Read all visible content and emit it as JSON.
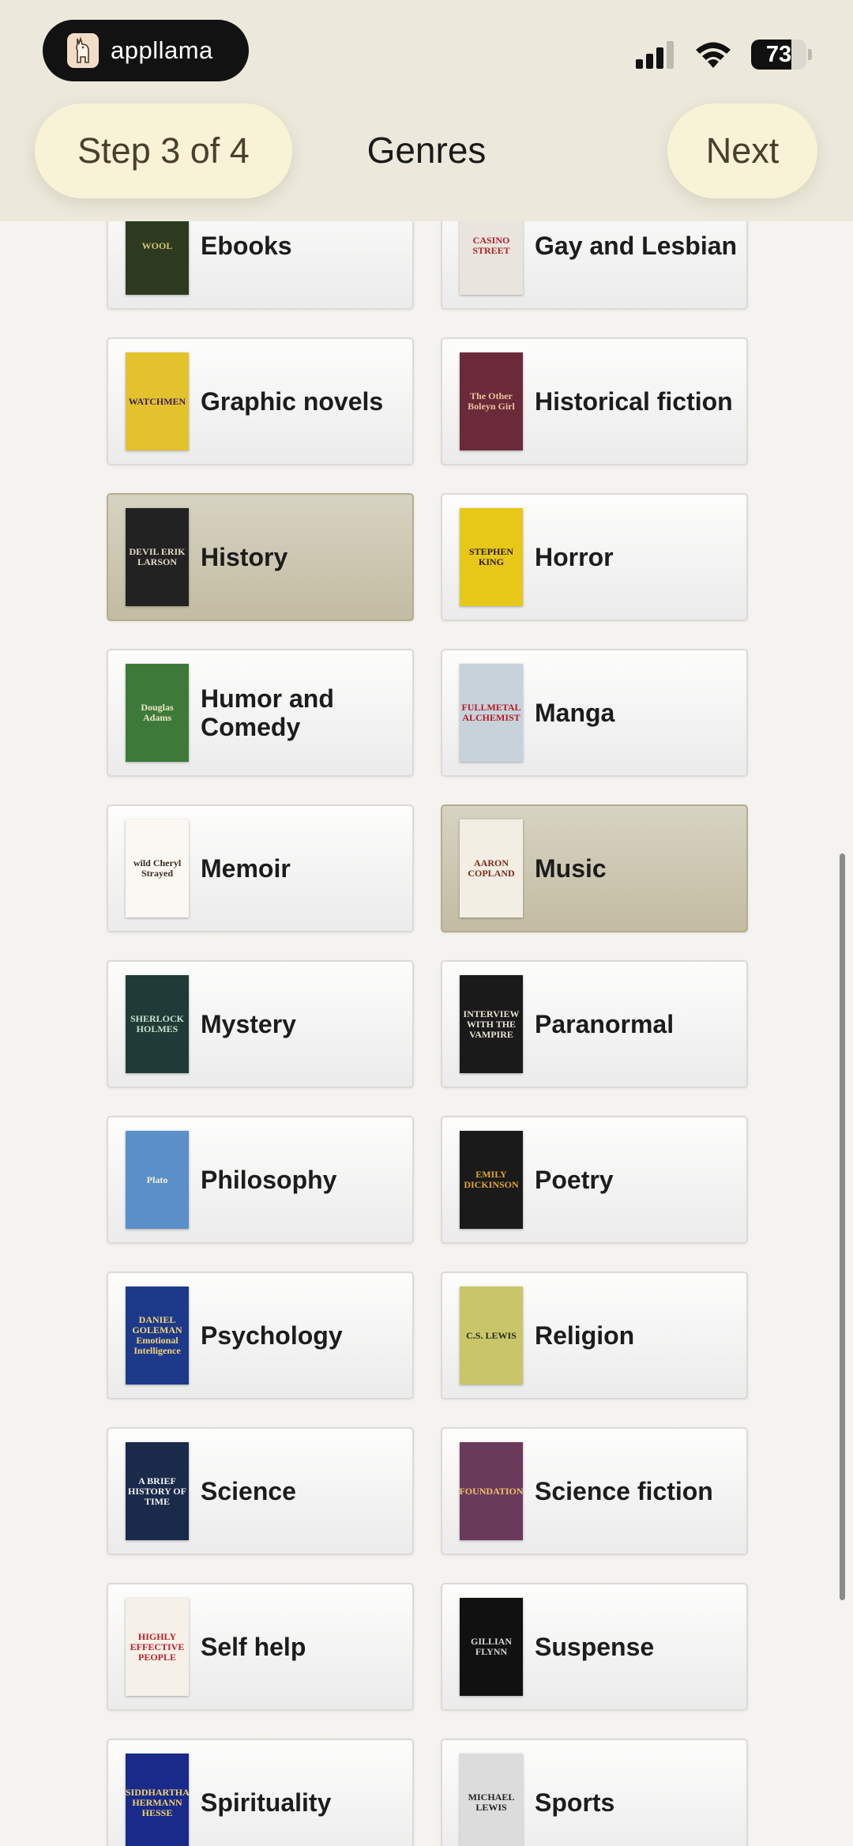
{
  "app": {
    "name": "appllama"
  },
  "status": {
    "battery": "73",
    "battery_fraction": 0.73
  },
  "header": {
    "step_label": "Step 3 of 4",
    "title": "Genres",
    "next_label": "Next"
  },
  "genres": [
    {
      "label": "Ebooks",
      "selected": false,
      "cover_text": "WOOL",
      "cover_bg": "#2d3a1f",
      "cover_fg": "#d7c27a"
    },
    {
      "label": "Gay and Lesbian",
      "selected": false,
      "cover_text": "CASINO STREET",
      "cover_bg": "#e9e4de",
      "cover_fg": "#b0222a"
    },
    {
      "label": "Graphic novels",
      "selected": false,
      "cover_text": "WATCHMEN",
      "cover_bg": "#e3c22d",
      "cover_fg": "#3a1d5c"
    },
    {
      "label": "Historical fiction",
      "selected": false,
      "cover_text": "The Other Boleyn Girl",
      "cover_bg": "#6b2a3a",
      "cover_fg": "#e9c49a"
    },
    {
      "label": "History",
      "selected": true,
      "cover_text": "DEVIL ERIK LARSON",
      "cover_bg": "#222222",
      "cover_fg": "#e0d8c4"
    },
    {
      "label": "Horror",
      "selected": false,
      "cover_text": "STEPHEN KING",
      "cover_bg": "#e7c819",
      "cover_fg": "#2a1b0a"
    },
    {
      "label": "Humor and Comedy",
      "selected": false,
      "cover_text": "Douglas Adams",
      "cover_bg": "#3d7a3a",
      "cover_fg": "#f0e6c8"
    },
    {
      "label": "Manga",
      "selected": false,
      "cover_text": "FULLMETAL ALCHEMIST",
      "cover_bg": "#c7d2da",
      "cover_fg": "#b4192a"
    },
    {
      "label": "Memoir",
      "selected": false,
      "cover_text": "wild Cheryl Strayed",
      "cover_bg": "#fbf8f3",
      "cover_fg": "#3b2a22"
    },
    {
      "label": "Music",
      "selected": true,
      "cover_text": "AARON COPLAND",
      "cover_bg": "#f3eee4",
      "cover_fg": "#7b2a1a"
    },
    {
      "label": "Mystery",
      "selected": false,
      "cover_text": "SHERLOCK HOLMES",
      "cover_bg": "#1f3b38",
      "cover_fg": "#c9e0cc"
    },
    {
      "label": "Paranormal",
      "selected": false,
      "cover_text": "INTERVIEW WITH THE VAMPIRE",
      "cover_bg": "#1a1a1a",
      "cover_fg": "#e6e0d2"
    },
    {
      "label": "Philosophy",
      "selected": false,
      "cover_text": "Plato",
      "cover_bg": "#5a8fc7",
      "cover_fg": "#f6f0e4"
    },
    {
      "label": "Poetry",
      "selected": false,
      "cover_text": "EMILY DICKINSON",
      "cover_bg": "#1a1a1a",
      "cover_fg": "#e0a72a"
    },
    {
      "label": "Psychology",
      "selected": false,
      "cover_text": "DANIEL GOLEMAN Emotional Intelligence",
      "cover_bg": "#1d3a8a",
      "cover_fg": "#f1d37a"
    },
    {
      "label": "Religion",
      "selected": false,
      "cover_text": "C.S. LEWIS",
      "cover_bg": "#c9c66a",
      "cover_fg": "#2a2a1a"
    },
    {
      "label": "Science",
      "selected": false,
      "cover_text": "A BRIEF HISTORY OF TIME",
      "cover_bg": "#1a2a4a",
      "cover_fg": "#f2f2f2"
    },
    {
      "label": "Science fiction",
      "selected": false,
      "cover_text": "FOUNDATION",
      "cover_bg": "#6a3a5a",
      "cover_fg": "#f2c06a"
    },
    {
      "label": "Self help",
      "selected": false,
      "cover_text": "HIGHLY EFFECTIVE PEOPLE",
      "cover_bg": "#f6f1e8",
      "cover_fg": "#b8202a"
    },
    {
      "label": "Suspense",
      "selected": false,
      "cover_text": "GILLIAN FLYNN",
      "cover_bg": "#111111",
      "cover_fg": "#d8d8d8"
    },
    {
      "label": "Spirituality",
      "selected": false,
      "cover_text": "SIDDHARTHA HERMANN HESSE",
      "cover_bg": "#1a2a8a",
      "cover_fg": "#f0d36a"
    },
    {
      "label": "Sports",
      "selected": false,
      "cover_text": "MICHAEL LEWIS",
      "cover_bg": "#dcdcdc",
      "cover_fg": "#222222"
    }
  ]
}
